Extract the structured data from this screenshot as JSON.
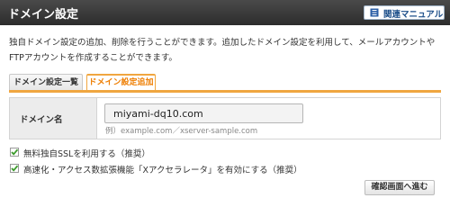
{
  "header": {
    "title": "ドメイン設定",
    "manual_label": "関連マニュアル"
  },
  "description": "独自ドメイン設定の追加、削除を行うことができます。追加したドメイン設定を利用して、メールアカウントやFTPアカウントを作成することができます。",
  "tabs": [
    {
      "label": "ドメイン設定一覧",
      "active": false
    },
    {
      "label": "ドメイン設定追加",
      "active": true
    }
  ],
  "form": {
    "domain_label": "ドメイン名",
    "domain_value": "miyami-dq10.com",
    "example": "例）example.com／xserver-sample.com"
  },
  "options": [
    {
      "label": "無料独自SSLを利用する（推奨）",
      "checked": true
    },
    {
      "label": "高速化・アクセス数拡張機能「Xアクセラレータ」を有効にする（推奨）",
      "checked": true
    }
  ],
  "confirm_button": "確認画面へ進む",
  "colors": {
    "accent": "#f0a640",
    "active_tab_text": "#ee7d00",
    "check": "#3a9a2a"
  },
  "icons": {
    "manual": "book-icon",
    "checkbox": "checkbox-checked-icon"
  }
}
